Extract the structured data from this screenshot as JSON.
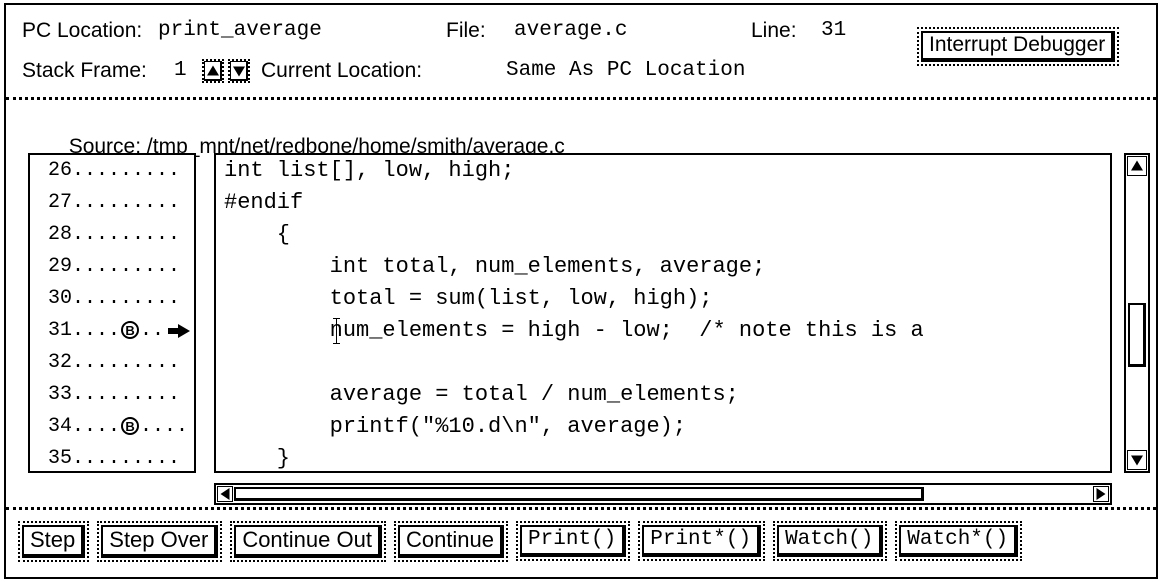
{
  "header": {
    "pc_location_label": "PC Location:",
    "pc_location_value": "print_average",
    "file_label": "File:",
    "file_value": "average.c",
    "line_label": "Line:",
    "line_value": "31",
    "interrupt_button": "Interrupt Debugger",
    "stack_frame_label": "Stack Frame:",
    "stack_frame_value": "1",
    "current_location_label": "Current Location:",
    "current_location_value": "Same As PC Location"
  },
  "source": {
    "label": "Source:",
    "path": "/tmp_mnt/net/redbone/home/smith/average.c",
    "gutter": [
      {
        "number": "26",
        "dots": ".........",
        "breakpoint": false,
        "pc": false
      },
      {
        "number": "27",
        "dots": ".........",
        "breakpoint": false,
        "pc": false
      },
      {
        "number": "28",
        "dots": ".........",
        "breakpoint": false,
        "pc": false
      },
      {
        "number": "29",
        "dots": ".........",
        "breakpoint": false,
        "pc": false
      },
      {
        "number": "30",
        "dots": ".........",
        "breakpoint": false,
        "pc": false
      },
      {
        "number": "31",
        "dots_before": "....",
        "breakpoint": true,
        "bp_glyph": "B",
        "dots_after": "..",
        "pc": true
      },
      {
        "number": "32",
        "dots": ".........",
        "breakpoint": false,
        "pc": false
      },
      {
        "number": "33",
        "dots": ".........",
        "breakpoint": false,
        "pc": false
      },
      {
        "number": "34",
        "dots_before": "....",
        "breakpoint": true,
        "bp_glyph": "B",
        "dots_after": "....",
        "pc": false
      },
      {
        "number": "35",
        "dots": ".........",
        "breakpoint": false,
        "pc": false
      }
    ],
    "code": [
      "int list[], low, high;",
      "#endif",
      "    {",
      "        int total, num_elements, average;",
      "        total = sum(list, low, high);",
      "        num_elements = high - low;  /* note this is a",
      "",
      "        average = total / num_elements;",
      "        printf(\"%10.d\\n\", average);",
      "    }"
    ]
  },
  "commands": [
    {
      "label": "Step",
      "mono": false
    },
    {
      "label": "Step Over",
      "mono": false
    },
    {
      "label": "Continue Out",
      "mono": false
    },
    {
      "label": "Continue",
      "mono": false
    },
    {
      "label": "Print()",
      "mono": true
    },
    {
      "label": "Print*()",
      "mono": true
    },
    {
      "label": "Watch()",
      "mono": true
    },
    {
      "label": "Watch*()",
      "mono": true
    }
  ],
  "colors": {
    "background": "#ffffff",
    "foreground": "#000000"
  }
}
